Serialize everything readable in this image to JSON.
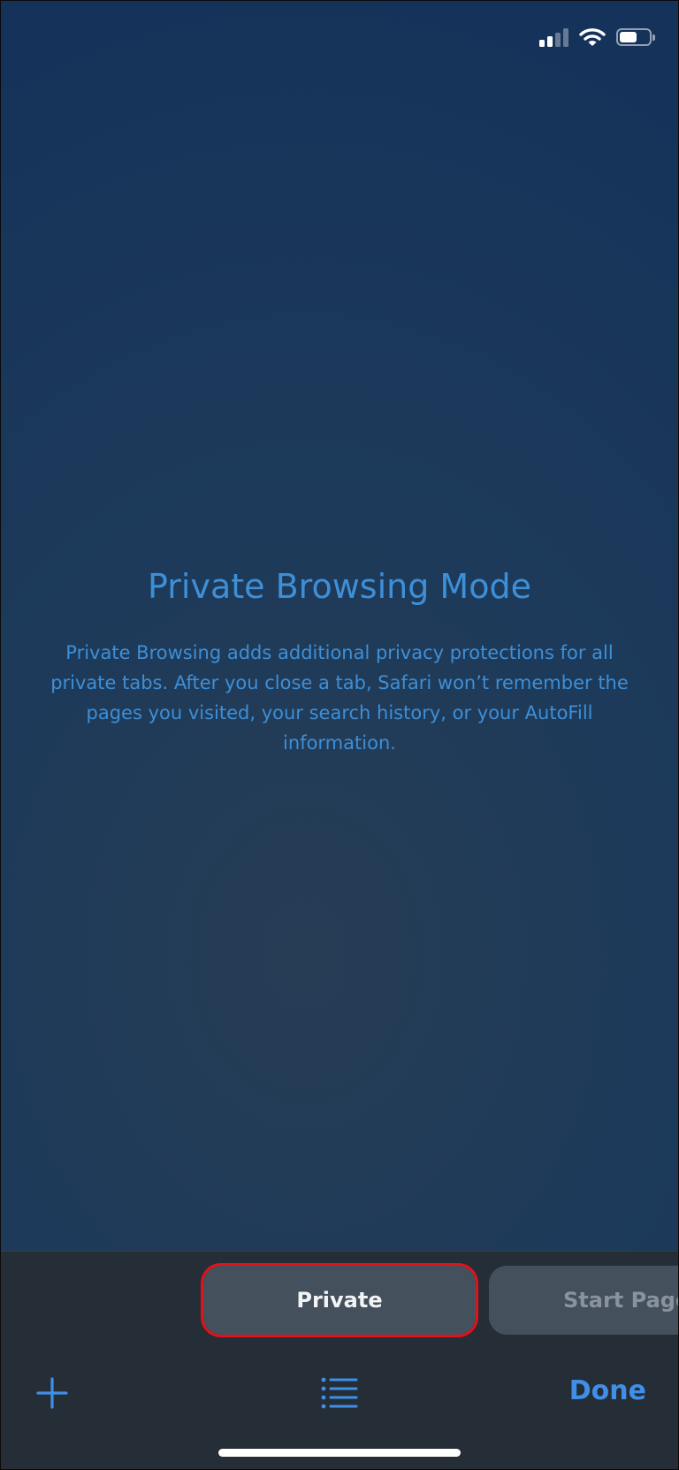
{
  "status_bar": {
    "signal_bars_active": 2,
    "signal_bars_total": 4,
    "battery_level": 0.6
  },
  "main": {
    "title": "Private Browsing Mode",
    "description": "Private Browsing adds additional privacy protections for all private tabs. After you close a tab, Safari won’t remember the pages you visited, your search history, or your AutoFill information."
  },
  "tab_groups": [
    {
      "label": "Private",
      "selected": true
    },
    {
      "label": "Start Page",
      "selected": false
    }
  ],
  "toolbar": {
    "new_tab_icon": "plus-icon",
    "tab_overview_icon": "list-icon",
    "done_label": "Done"
  },
  "colors": {
    "accent": "#3f8fe8",
    "title_text": "#3d8fd8",
    "highlight_outline": "#e0121b",
    "toolbar_bg": "#252d36"
  }
}
